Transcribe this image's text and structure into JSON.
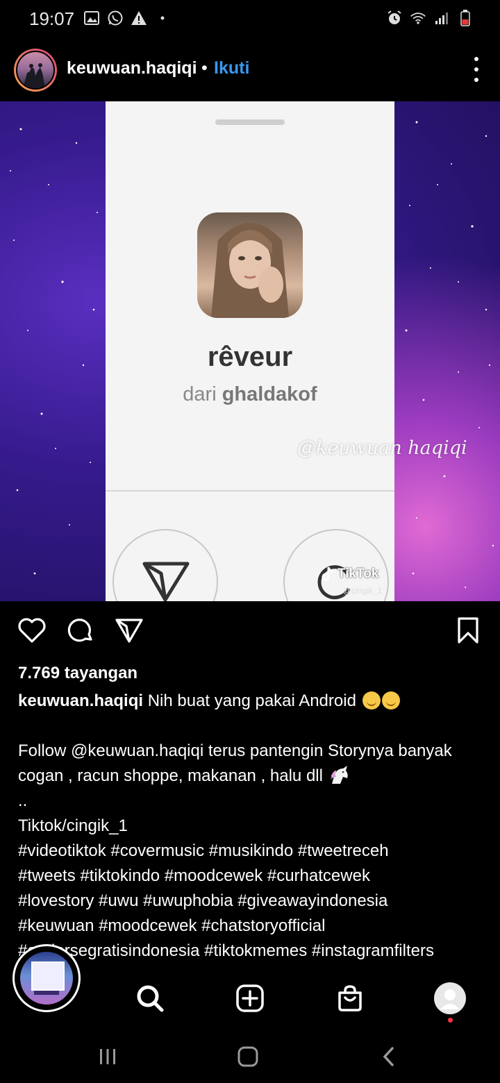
{
  "status_bar": {
    "time": "19:07"
  },
  "post": {
    "username": "keuwuan.haqiqi",
    "separator": "•",
    "follow_label": "Ikuti"
  },
  "media": {
    "card_title": "rêveur",
    "card_sub_prefix": "dari",
    "card_sub_author": "ghaldakof",
    "watermark": "@keuwuan haqiqi",
    "tiktok_label": "TikTok",
    "tiktok_handle": "@cingik_1"
  },
  "engagement": {
    "views": "7.769 tayangan"
  },
  "caption": {
    "username": "keuwuan.haqiqi",
    "line1_text": "Nih buat yang pakai Android",
    "line2": "Follow @keuwuan.haqiqi terus pantengin Storynya banyak",
    "line3": "cogan , racun shoppe, makanan , halu dll",
    "line4": "..",
    "line5": "Tiktok/cingik_1",
    "line6": "#videotiktok #covermusic #musikindo #tweetreceh",
    "line7": "#tweets #tiktokindo #moodcewek #curhatcewek",
    "line8": "#lovestory #uwu #uwuphobia #giveawayindonesia",
    "line9": "#keuwuan #moodcewek #chatstoryofficial",
    "line10": "#endorsegratisindonesia #tiktokmemes #instagramfilters"
  },
  "icons": [
    "heart-icon",
    "comment-icon",
    "share-icon",
    "bookmark-icon",
    "search-icon",
    "add-post-icon",
    "shop-icon",
    "profile-icon"
  ],
  "colors": {
    "follow": "#3897f0",
    "background": "#000000",
    "notification_dot": "#ff3040"
  }
}
